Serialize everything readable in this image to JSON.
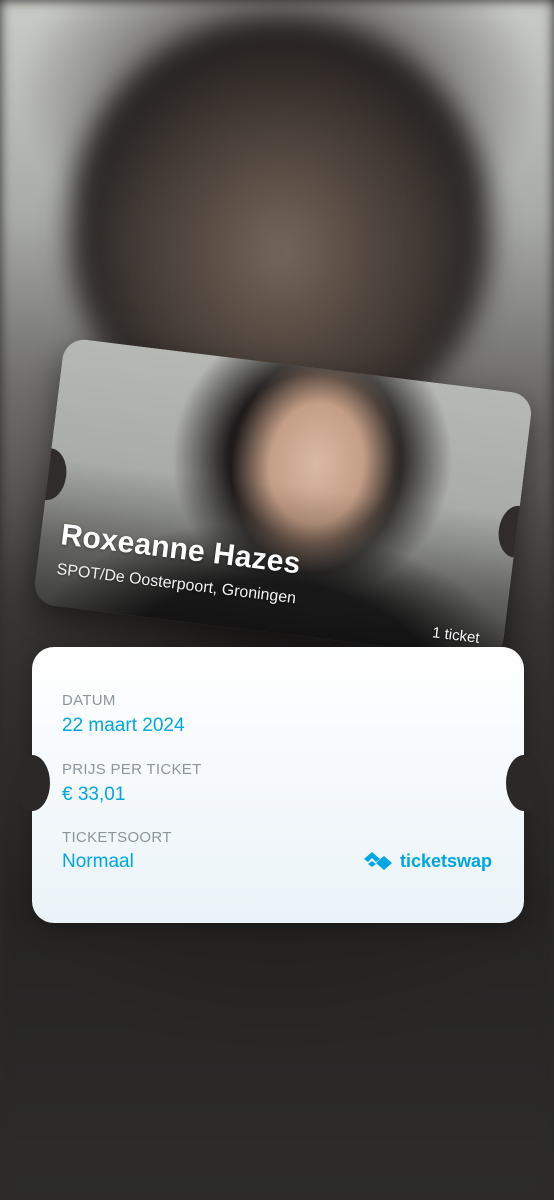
{
  "ticket": {
    "artist": "Roxeanne Hazes",
    "venue": "SPOT/De Oosterpoort, Groningen",
    "count_label": "1 ticket"
  },
  "details": {
    "date_label": "DATUM",
    "date_value": "22 maart 2024",
    "price_label": "PRIJS PER TICKET",
    "price_value": "€ 33,01",
    "type_label": "TICKETSOORT",
    "type_value": "Normaal"
  },
  "brand": {
    "name": "ticketswap",
    "icon": "ticketswap-logo-icon"
  },
  "colors": {
    "accent": "#00a6e2",
    "label": "#8b969d",
    "card": "#ffffff"
  }
}
